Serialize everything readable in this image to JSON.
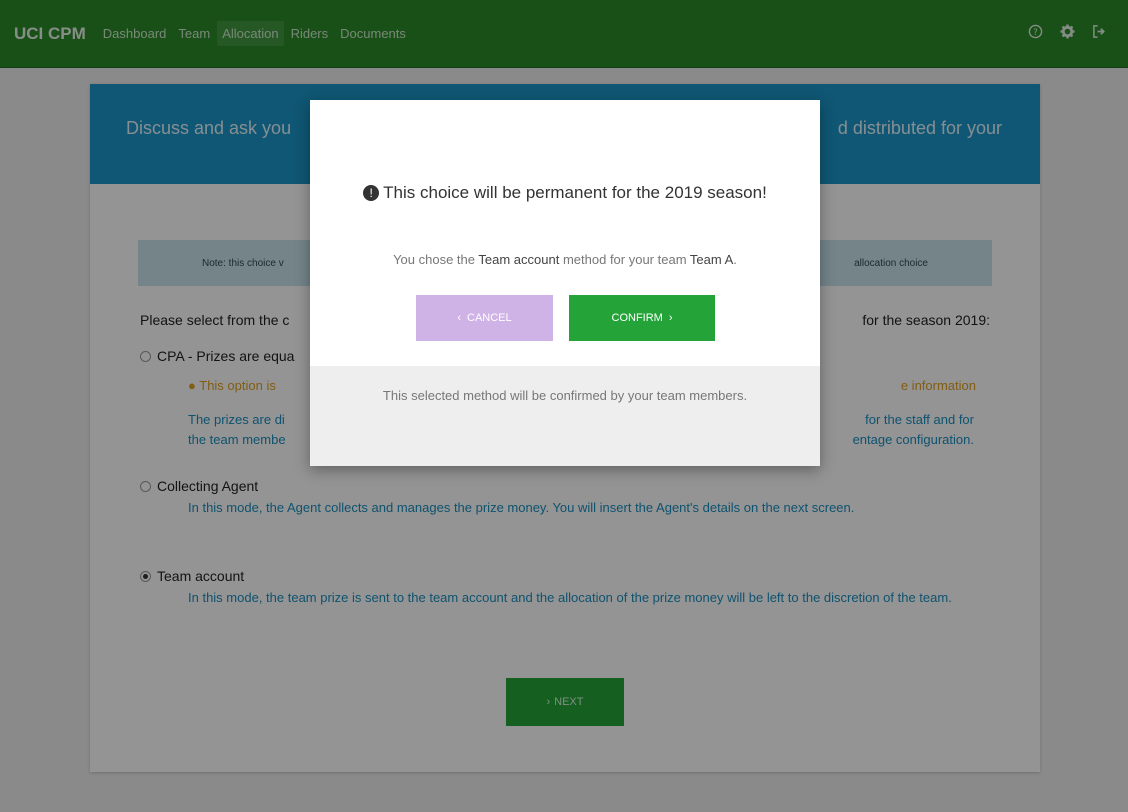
{
  "navbar": {
    "brand": "UCI CPM",
    "items": [
      {
        "label": "Dashboard",
        "active": false
      },
      {
        "label": "Team",
        "active": false
      },
      {
        "label": "Allocation",
        "active": true
      },
      {
        "label": "Riders",
        "active": false
      },
      {
        "label": "Documents",
        "active": false
      }
    ],
    "icons": [
      "help-icon",
      "settings-icon",
      "logout-icon"
    ]
  },
  "card": {
    "header_left": "Discuss and ask you",
    "header_right": "d distributed for your",
    "note_left": "Note: this choice v",
    "note_right": "allocation choice",
    "instruction_left": "Please select from the c",
    "instruction_right": "for the season 2019:",
    "options": [
      {
        "label": "CPA - Prizes are equa",
        "checked": false,
        "warning_left": "This option is",
        "warning_right": "e information",
        "desc_left_1": "The prizes are di",
        "desc_left_2": "the team membe",
        "desc_right_1": "for the staff and for",
        "desc_right_2": "entage configuration."
      },
      {
        "label": "Collecting Agent",
        "checked": false,
        "description": "In this mode, the Agent collects and manages the prize money. You will insert the Agent's details on the next screen."
      },
      {
        "label": "Team account",
        "checked": true,
        "description": "In this mode, the team prize is sent to the team account and the allocation of the prize money will be left to the discretion of the team."
      }
    ],
    "next_label": "NEXT"
  },
  "modal": {
    "title": "This choice will be permanent for the 2019 season!",
    "text_prefix": "You chose the",
    "method": "Team account",
    "text_middle": "method for your team",
    "team": "Team A",
    "cancel_label": "CANCEL",
    "confirm_label": "CONFIRM",
    "footer": "This selected method will be confirmed by your team members."
  },
  "colors": {
    "navbar": "#2a8a2a",
    "header": "#1b97c9",
    "confirm": "#24a438",
    "cancel": "#d0b3e6"
  }
}
